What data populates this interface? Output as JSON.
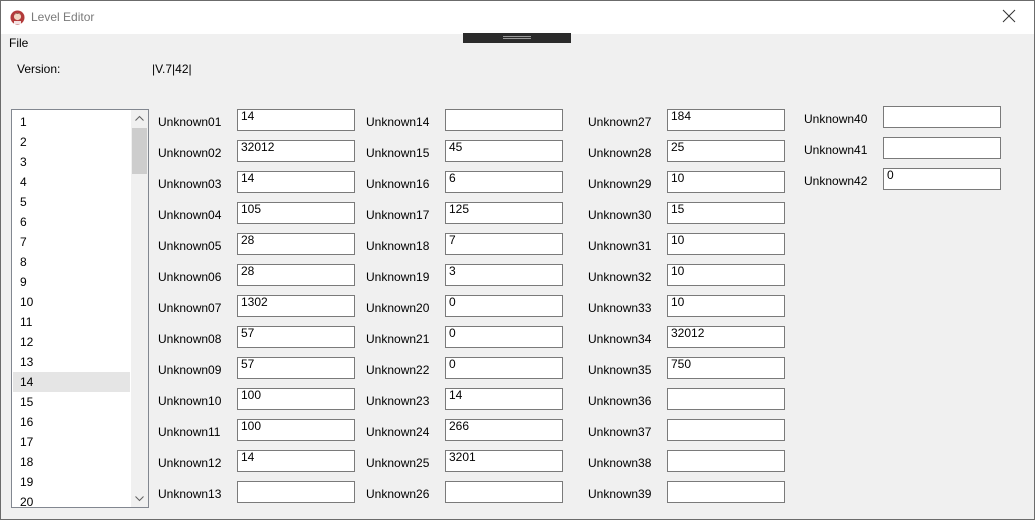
{
  "window": {
    "title": "Level Editor",
    "menu": [
      "File"
    ]
  },
  "version": {
    "label": "Version:",
    "value": "|V.7|42|"
  },
  "level_list": {
    "items": [
      "1",
      "2",
      "3",
      "4",
      "5",
      "6",
      "7",
      "8",
      "9",
      "10",
      "11",
      "12",
      "13",
      "14",
      "15",
      "16",
      "17",
      "18",
      "19",
      "20"
    ],
    "selected": "14"
  },
  "fields": [
    {
      "label": "Unknown01",
      "value": "14"
    },
    {
      "label": "Unknown02",
      "value": "32012"
    },
    {
      "label": "Unknown03",
      "value": "14"
    },
    {
      "label": "Unknown04",
      "value": "105"
    },
    {
      "label": "Unknown05",
      "value": "28"
    },
    {
      "label": "Unknown06",
      "value": "28"
    },
    {
      "label": "Unknown07",
      "value": "1302"
    },
    {
      "label": "Unknown08",
      "value": "57"
    },
    {
      "label": "Unknown09",
      "value": "57"
    },
    {
      "label": "Unknown10",
      "value": "100"
    },
    {
      "label": "Unknown11",
      "value": "100"
    },
    {
      "label": "Unknown12",
      "value": "14"
    },
    {
      "label": "Unknown13",
      "value": ""
    },
    {
      "label": "Unknown14",
      "value": ""
    },
    {
      "label": "Unknown15",
      "value": "45"
    },
    {
      "label": "Unknown16",
      "value": "6"
    },
    {
      "label": "Unknown17",
      "value": "125"
    },
    {
      "label": "Unknown18",
      "value": "7"
    },
    {
      "label": "Unknown19",
      "value": "3"
    },
    {
      "label": "Unknown20",
      "value": "0"
    },
    {
      "label": "Unknown21",
      "value": "0"
    },
    {
      "label": "Unknown22",
      "value": "0"
    },
    {
      "label": "Unknown23",
      "value": "14"
    },
    {
      "label": "Unknown24",
      "value": "266"
    },
    {
      "label": "Unknown25",
      "value": "3201"
    },
    {
      "label": "Unknown26",
      "value": ""
    },
    {
      "label": "Unknown27",
      "value": "184"
    },
    {
      "label": "Unknown28",
      "value": "25"
    },
    {
      "label": "Unknown29",
      "value": "10"
    },
    {
      "label": "Unknown30",
      "value": "15"
    },
    {
      "label": "Unknown31",
      "value": "10"
    },
    {
      "label": "Unknown32",
      "value": "10"
    },
    {
      "label": "Unknown33",
      "value": "10"
    },
    {
      "label": "Unknown34",
      "value": "32012"
    },
    {
      "label": "Unknown35",
      "value": "750"
    },
    {
      "label": "Unknown36",
      "value": ""
    },
    {
      "label": "Unknown37",
      "value": ""
    },
    {
      "label": "Unknown38",
      "value": ""
    },
    {
      "label": "Unknown39",
      "value": ""
    },
    {
      "label": "Unknown40",
      "value": ""
    },
    {
      "label": "Unknown41",
      "value": ""
    },
    {
      "label": "Unknown42",
      "value": "0"
    }
  ]
}
